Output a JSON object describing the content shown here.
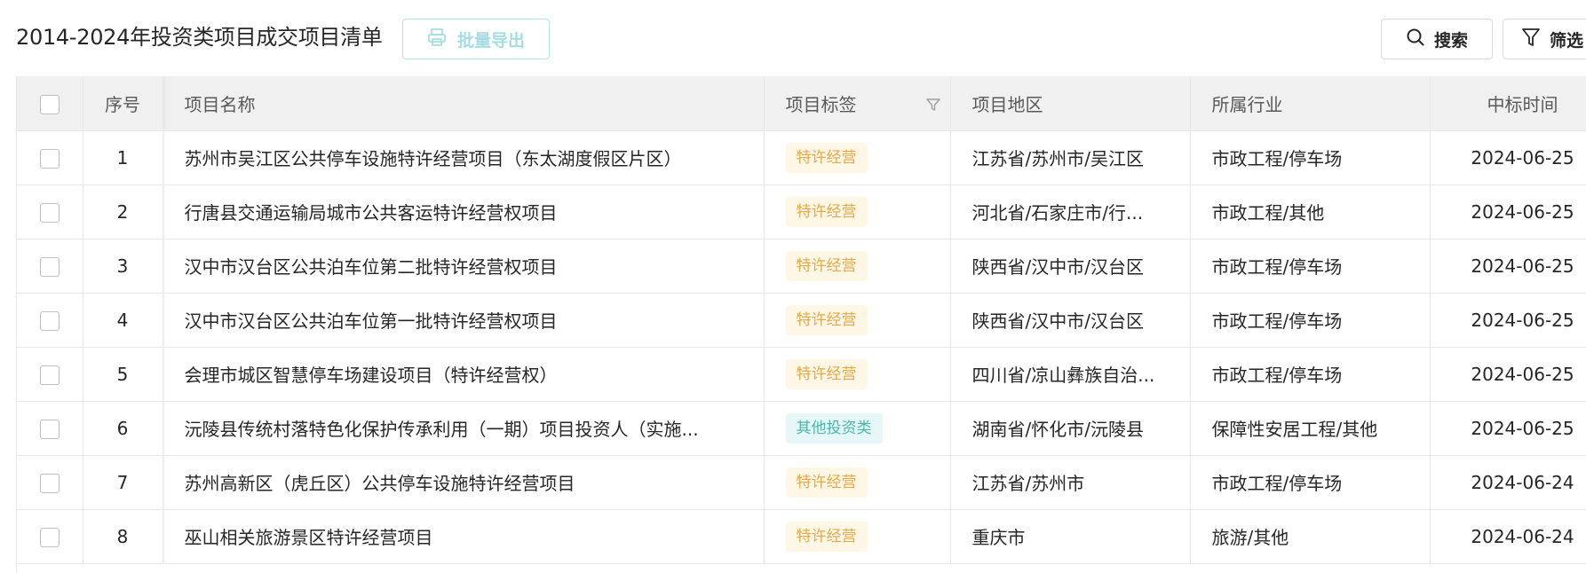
{
  "header": {
    "title": "2014-2024年投资类项目成交项目清单",
    "export_label": "批量导出",
    "search_label": "搜索",
    "filter_label": "筛选"
  },
  "icons": {
    "export": "printer-icon",
    "search": "search-icon",
    "filter": "filter-funnel-icon",
    "column_filter": "column-filter-icon"
  },
  "colors": {
    "accent_light": "#a6dde3",
    "tag_warn_bg": "#fff7e6",
    "tag_warn_text": "#e3a94b",
    "tag_info_bg": "#e6f7f7",
    "tag_info_text": "#4cb6ad",
    "header_bg": "#f0f0f0"
  },
  "table": {
    "columns": {
      "seq": "序号",
      "name": "项目名称",
      "tag": "项目标签",
      "region": "项目地区",
      "industry": "所属行业",
      "date": "中标时间"
    },
    "rows": [
      {
        "seq": "1",
        "name": "苏州市吴江区公共停车设施特许经营项目（东太湖度假区片区）",
        "tag": "特许经营",
        "tag_type": "warn",
        "region": "江苏省/苏州市/吴江区",
        "industry": "市政工程/停车场",
        "date": "2024-06-25"
      },
      {
        "seq": "2",
        "name": "行唐县交通运输局城市公共客运特许经营权项目",
        "tag": "特许经营",
        "tag_type": "warn",
        "region": "河北省/石家庄市/行...",
        "industry": "市政工程/其他",
        "date": "2024-06-25"
      },
      {
        "seq": "3",
        "name": "汉中市汉台区公共泊车位第二批特许经营权项目",
        "tag": "特许经营",
        "tag_type": "warn",
        "region": "陕西省/汉中市/汉台区",
        "industry": "市政工程/停车场",
        "date": "2024-06-25"
      },
      {
        "seq": "4",
        "name": "汉中市汉台区公共泊车位第一批特许经营权项目",
        "tag": "特许经营",
        "tag_type": "warn",
        "region": "陕西省/汉中市/汉台区",
        "industry": "市政工程/停车场",
        "date": "2024-06-25"
      },
      {
        "seq": "5",
        "name": "会理市城区智慧停车场建设项目（特许经营权）",
        "tag": "特许经营",
        "tag_type": "warn",
        "region": "四川省/凉山彝族自治...",
        "industry": "市政工程/停车场",
        "date": "2024-06-25"
      },
      {
        "seq": "6",
        "name": "沅陵县传统村落特色化保护传承利用（一期）项目投资人（实施...",
        "tag": "其他投资类",
        "tag_type": "info",
        "region": "湖南省/怀化市/沅陵县",
        "industry": "保障性安居工程/其他",
        "date": "2024-06-25"
      },
      {
        "seq": "7",
        "name": "苏州高新区（虎丘区）公共停车设施特许经营项目",
        "tag": "特许经营",
        "tag_type": "warn",
        "region": "江苏省/苏州市",
        "industry": "市政工程/停车场",
        "date": "2024-06-24"
      },
      {
        "seq": "8",
        "name": "巫山相关旅游景区特许经营项目",
        "tag": "特许经营",
        "tag_type": "warn",
        "region": "重庆市",
        "industry": "旅游/其他",
        "date": "2024-06-24"
      }
    ]
  }
}
